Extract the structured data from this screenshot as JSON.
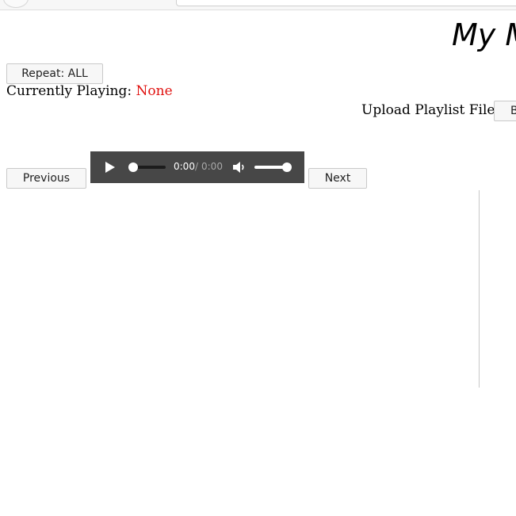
{
  "page": {
    "title": "My M"
  },
  "controls": {
    "repeat_label": "Repeat: ALL",
    "currently_playing_label": "Currently Playing:",
    "currently_playing_value": "None",
    "upload_label": "Upload Playlist File:",
    "browse_label": "B",
    "previous_label": "Previous",
    "next_label": "Next"
  },
  "player": {
    "current_time": "0:00",
    "separator": "/",
    "total_time": "0:00",
    "progress": 0,
    "volume": 1,
    "icons": {
      "play": "play-icon",
      "volume": "volume-icon"
    }
  },
  "colors": {
    "accent_none": "#e0110f",
    "player_bg": "#474747"
  }
}
